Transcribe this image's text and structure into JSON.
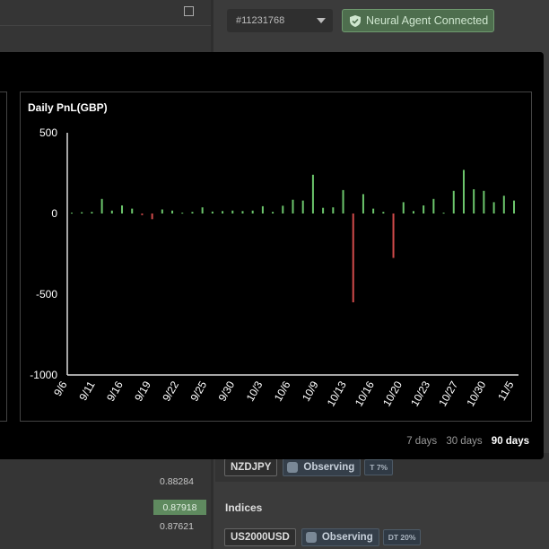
{
  "header": {
    "account_id": "#11231768",
    "connection_status": "Neural Agent Connected",
    "status_color": "#4e6e4e"
  },
  "chart_panel": {
    "title": "Daily PnL(GBP)",
    "range_options": [
      "7 days",
      "30 days",
      "90 days"
    ],
    "selected_range": "90 days"
  },
  "chart_data": {
    "type": "bar",
    "title": "Daily PnL(GBP)",
    "xlabel": "",
    "ylabel": "",
    "ylim": [
      -1000,
      500
    ],
    "yticks": [
      500,
      0,
      -500,
      -1000
    ],
    "xtick_labels": [
      "9/6",
      "9/11",
      "9/16",
      "9/19",
      "9/22",
      "9/25",
      "9/30",
      "10/3",
      "10/6",
      "10/9",
      "10/13",
      "10/16",
      "10/20",
      "10/23",
      "10/27",
      "10/30",
      "11/5"
    ],
    "grid": false,
    "positive_color": "#6cc66c",
    "negative_color": "#d04a4a",
    "values": [
      5,
      8,
      10,
      90,
      18,
      50,
      30,
      -10,
      -35,
      25,
      18,
      5,
      10,
      38,
      12,
      15,
      18,
      15,
      18,
      45,
      10,
      48,
      85,
      80,
      240,
      35,
      38,
      145,
      -550,
      120,
      30,
      10,
      -275,
      70,
      15,
      50,
      90,
      5,
      140,
      270,
      150,
      140,
      70,
      110,
      80
    ]
  },
  "watchlist": {
    "prices": [
      "0.88284",
      "0.87918",
      "0.87621"
    ],
    "highlighted_price": "0.87918",
    "rows": [
      {
        "symbol": "NZDJPY",
        "status": "Observing",
        "tag": "T 7%"
      }
    ],
    "indices_label": "Indices",
    "indices_rows": [
      {
        "symbol": "US2000USD",
        "status": "Observing",
        "tag": "DT 20%"
      }
    ]
  }
}
